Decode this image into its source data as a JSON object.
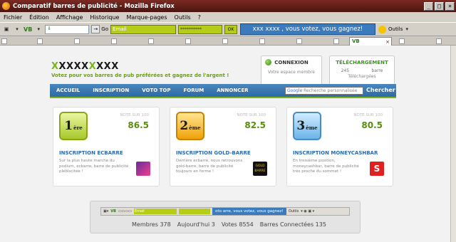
{
  "window": {
    "title": "Comparatif barres de publicité - Mozilla Firefox",
    "minimize": "_",
    "maximize": "□",
    "close": "×"
  },
  "menu": [
    "Fichier",
    "Édition",
    "Affichage",
    "Historique",
    "Marque-pages",
    "Outils",
    "?"
  ],
  "toolbar": {
    "vb": "VB",
    "dropdown_arrow": "⇓",
    "go": "Go",
    "email_placeholder": "Email",
    "password": "**********",
    "ok": "OK",
    "banner": "xxx xxxx , vous votez, vous gagnez!",
    "outils": "Outils"
  },
  "tabs": {
    "vb_tab": "VB"
  },
  "site": {
    "logo_g": "X",
    "logo_d": "XXXX",
    "logo_g2": "X",
    "logo_d2": "XXX",
    "tagline": "Votez pour vos barres de pub préférées et gagnez de l'argent !",
    "login": {
      "title": "CONNEXION",
      "subtitle": "Votre espace membre"
    },
    "download": {
      "title": "TÉLÉCHARGEMENT",
      "count": "245",
      "bars_label": "barre",
      "downloaded": "Téléchargées"
    },
    "nav": [
      "ACCUEIL",
      "INSCRIPTION",
      "VOTO TOP",
      "FORUM",
      "ANNONCER"
    ],
    "search_google": "Google",
    "search_placeholder": "Recherche personnalisée",
    "search_button": "Chercher"
  },
  "cards": [
    {
      "rank": "1",
      "rank_suffix": "ère",
      "note_label": "NOTE SUR 100",
      "score": "86.5",
      "title": "INSCRIPTION ECBARRE",
      "desc": "Sur la plus haute marche du podium, ecbarre, barre de publicité plébiscitée !"
    },
    {
      "rank": "2",
      "rank_suffix": "ème",
      "note_label": "NOTE SUR 100",
      "score": "82.5",
      "title": "INSCRIPTION GOLD-BARRE",
      "desc": "Derrière ecbarre, nous retrouvons gold-barre, barre de publicité toujours en forme !",
      "badge": "GOLD BARRE"
    },
    {
      "rank": "3",
      "rank_suffix": "ème",
      "note_label": "NOTE SUR 100",
      "score": "80.5",
      "title": "INSCRIPTION MONEYCASHBAR",
      "desc": "En troisième position, moneycashbar, barre de publicité très proche du sommet !",
      "badge": "S"
    }
  ],
  "stats_toolbar": {
    "email": "Email",
    "banner": "oto arre, vous votez, vous gagnez!",
    "outils": "Outils"
  },
  "stats": {
    "members": "Membres 378",
    "today": "Aujourd'hui 3",
    "votes": "Votes 8554",
    "connected": "Barres Connectées 135"
  }
}
